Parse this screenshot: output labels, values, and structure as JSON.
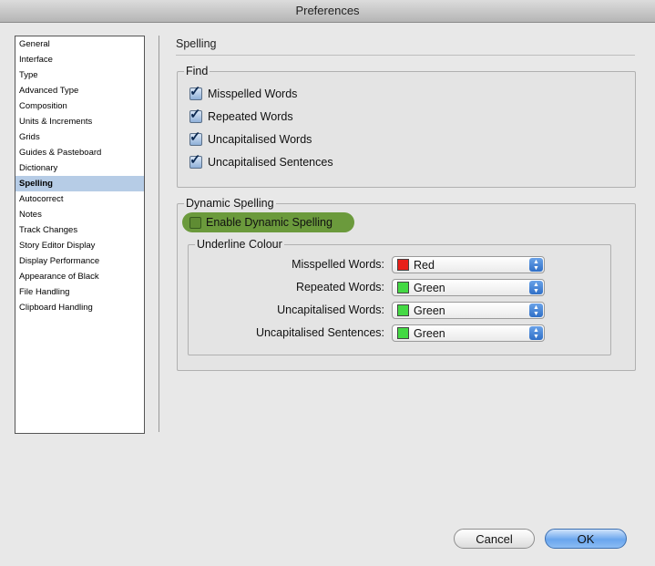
{
  "window": {
    "title": "Preferences"
  },
  "sidebar": {
    "items": [
      {
        "label": "General"
      },
      {
        "label": "Interface"
      },
      {
        "label": "Type"
      },
      {
        "label": "Advanced Type"
      },
      {
        "label": "Composition"
      },
      {
        "label": "Units & Increments"
      },
      {
        "label": "Grids"
      },
      {
        "label": "Guides & Pasteboard"
      },
      {
        "label": "Dictionary"
      },
      {
        "label": "Spelling"
      },
      {
        "label": "Autocorrect"
      },
      {
        "label": "Notes"
      },
      {
        "label": "Track Changes"
      },
      {
        "label": "Story Editor Display"
      },
      {
        "label": "Display Performance"
      },
      {
        "label": "Appearance of Black"
      },
      {
        "label": "File Handling"
      },
      {
        "label": "Clipboard Handling"
      }
    ],
    "selected": "Spelling"
  },
  "main": {
    "title": "Spelling",
    "find": {
      "legend": "Find",
      "options": [
        {
          "label": "Misspelled Words",
          "checked": true
        },
        {
          "label": "Repeated Words",
          "checked": true
        },
        {
          "label": "Uncapitalised Words",
          "checked": true
        },
        {
          "label": "Uncapitalised Sentences",
          "checked": true
        }
      ]
    },
    "dynamic": {
      "legend": "Dynamic Spelling",
      "enable_label": "Enable Dynamic Spelling",
      "enable_checked": false,
      "underline": {
        "legend": "Underline Colour",
        "rows": [
          {
            "label": "Misspelled Words:",
            "value": "Red",
            "color": "#e8201a"
          },
          {
            "label": "Repeated Words:",
            "value": "Green",
            "color": "#44d944"
          },
          {
            "label": "Uncapitalised Words:",
            "value": "Green",
            "color": "#44d944"
          },
          {
            "label": "Uncapitalised Sentences:",
            "value": "Green",
            "color": "#44d944"
          }
        ]
      }
    }
  },
  "buttons": {
    "cancel": "Cancel",
    "ok": "OK"
  }
}
